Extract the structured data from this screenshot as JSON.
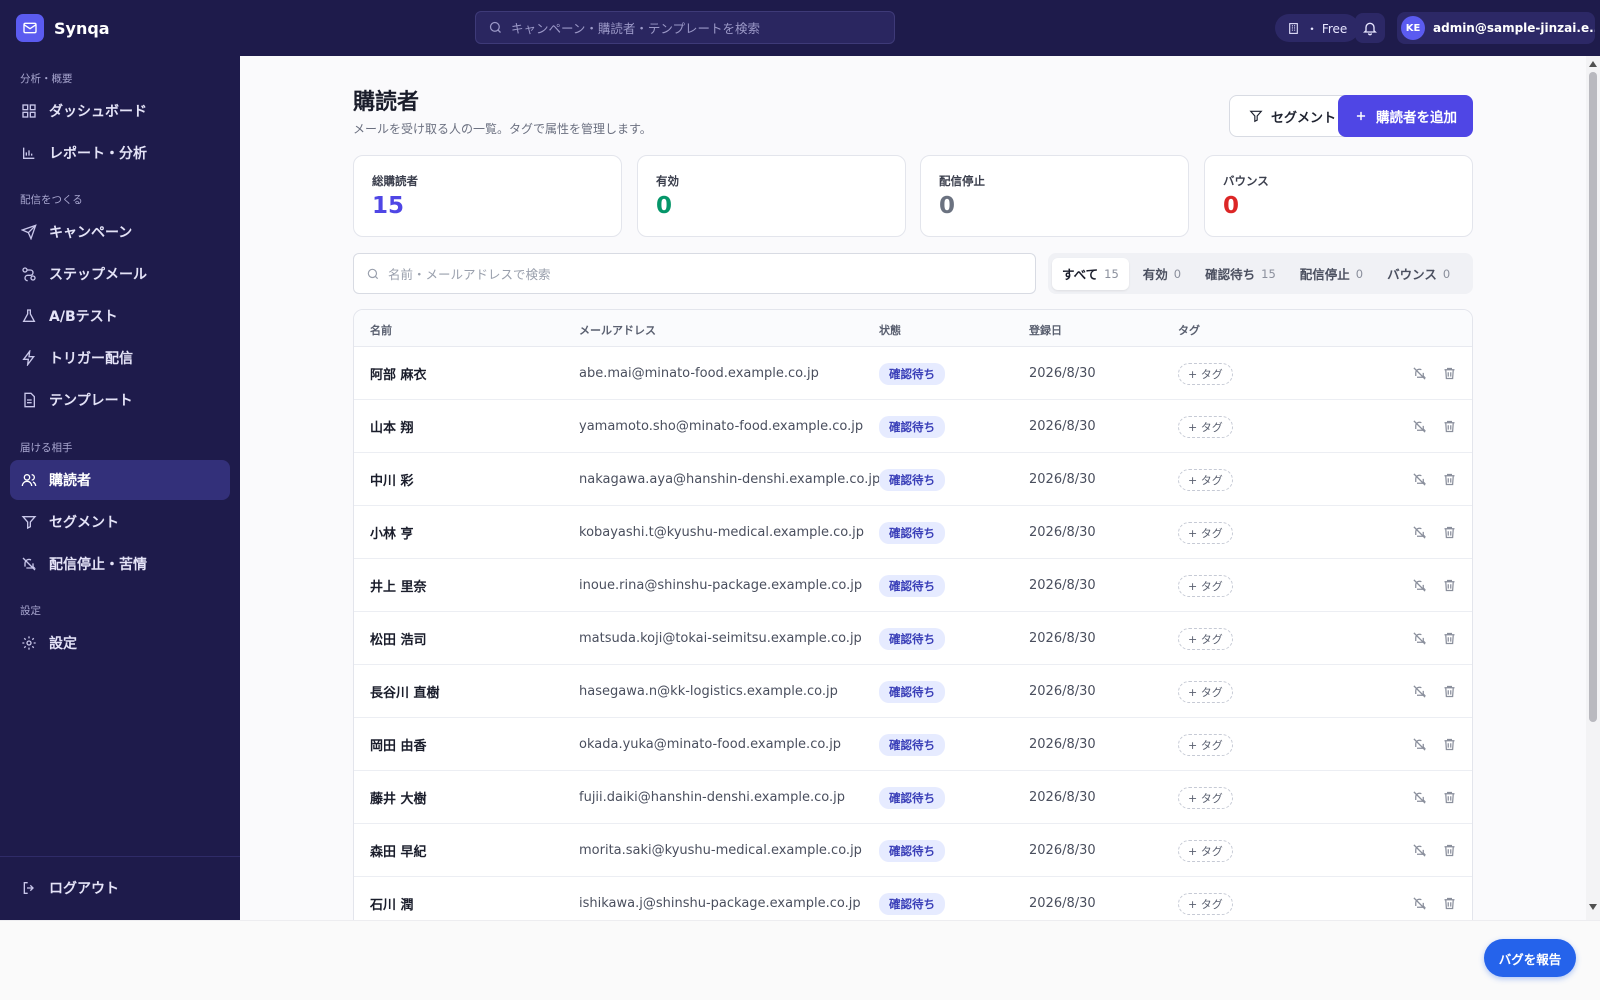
{
  "app": {
    "name": "Synqa"
  },
  "topbar": {
    "search_placeholder": "キャンペーン・購読者・テンプレートを検索",
    "plan_label": "・ Free",
    "user_initials": "KE",
    "user_email": "admin@sample-jinzai.e..."
  },
  "sidebar": {
    "sections": [
      {
        "label": "分析・概要"
      },
      {
        "label": "配信をつくる"
      },
      {
        "label": "届ける相手"
      },
      {
        "label": "設定"
      }
    ],
    "items": [
      {
        "label": "ダッシュボード",
        "icon": "grid-icon"
      },
      {
        "label": "レポート・分析",
        "icon": "bar-chart-icon"
      },
      {
        "label": "キャンペーン",
        "icon": "send-icon"
      },
      {
        "label": "ステップメール",
        "icon": "route-icon"
      },
      {
        "label": "A/Bテスト",
        "icon": "flask-icon"
      },
      {
        "label": "トリガー配信",
        "icon": "bolt-icon"
      },
      {
        "label": "テンプレート",
        "icon": "file-icon"
      },
      {
        "label": "購読者",
        "icon": "users-icon",
        "active": true
      },
      {
        "label": "セグメント",
        "icon": "filter-icon"
      },
      {
        "label": "配信停止・苦情",
        "icon": "bell-off-icon"
      },
      {
        "label": "設定",
        "icon": "gear-icon"
      }
    ],
    "logout_label": "ログアウト"
  },
  "page": {
    "title": "購読者",
    "subtitle": "メールを受け取る人の一覧。タグで属性を管理します。",
    "segment_button": "セグメント",
    "add_button": "購読者を追加"
  },
  "stats": [
    {
      "label": "総購読者",
      "value": "15",
      "color": "#4f46e5"
    },
    {
      "label": "有効",
      "value": "0",
      "color": "#059669"
    },
    {
      "label": "配信停止",
      "value": "0",
      "color": "#6b7280"
    },
    {
      "label": "バウンス",
      "value": "0",
      "color": "#dc2626"
    }
  ],
  "list_search_placeholder": "名前・メールアドレスで検索",
  "filters": [
    {
      "label": "すべて",
      "count": "15",
      "active": true
    },
    {
      "label": "有効",
      "count": "0"
    },
    {
      "label": "確認待ち",
      "count": "15"
    },
    {
      "label": "配信停止",
      "count": "0"
    },
    {
      "label": "バウンス",
      "count": "0"
    }
  ],
  "table": {
    "headers": {
      "name": "名前",
      "email": "メールアドレス",
      "status": "状態",
      "date": "登録日",
      "tags": "タグ"
    },
    "tag_button": "+ タグ",
    "rows": [
      {
        "name": "阿部 麻衣",
        "email": "abe.mai@minato-food.example.co.jp",
        "status": "確認待ち",
        "date": "2026/8/30"
      },
      {
        "name": "山本 翔",
        "email": "yamamoto.sho@minato-food.example.co.jp",
        "status": "確認待ち",
        "date": "2026/8/30"
      },
      {
        "name": "中川 彩",
        "email": "nakagawa.aya@hanshin-denshi.example.co.jp",
        "status": "確認待ち",
        "date": "2026/8/30"
      },
      {
        "name": "小林 亨",
        "email": "kobayashi.t@kyushu-medical.example.co.jp",
        "status": "確認待ち",
        "date": "2026/8/30"
      },
      {
        "name": "井上 里奈",
        "email": "inoue.rina@shinshu-package.example.co.jp",
        "status": "確認待ち",
        "date": "2026/8/30"
      },
      {
        "name": "松田 浩司",
        "email": "matsuda.koji@tokai-seimitsu.example.co.jp",
        "status": "確認待ち",
        "date": "2026/8/30"
      },
      {
        "name": "長谷川 直樹",
        "email": "hasegawa.n@kk-logistics.example.co.jp",
        "status": "確認待ち",
        "date": "2026/8/30"
      },
      {
        "name": "岡田 由香",
        "email": "okada.yuka@minato-food.example.co.jp",
        "status": "確認待ち",
        "date": "2026/8/30"
      },
      {
        "name": "藤井 大樹",
        "email": "fujii.daiki@hanshin-denshi.example.co.jp",
        "status": "確認待ち",
        "date": "2026/8/30"
      },
      {
        "name": "森田 早紀",
        "email": "morita.saki@kyushu-medical.example.co.jp",
        "status": "確認待ち",
        "date": "2026/8/30"
      },
      {
        "name": "石川 潤",
        "email": "ishikawa.j@shinshu-package.example.co.jp",
        "status": "確認待ち",
        "date": "2026/8/30"
      }
    ]
  },
  "bug_report_button": "バグを報告"
}
